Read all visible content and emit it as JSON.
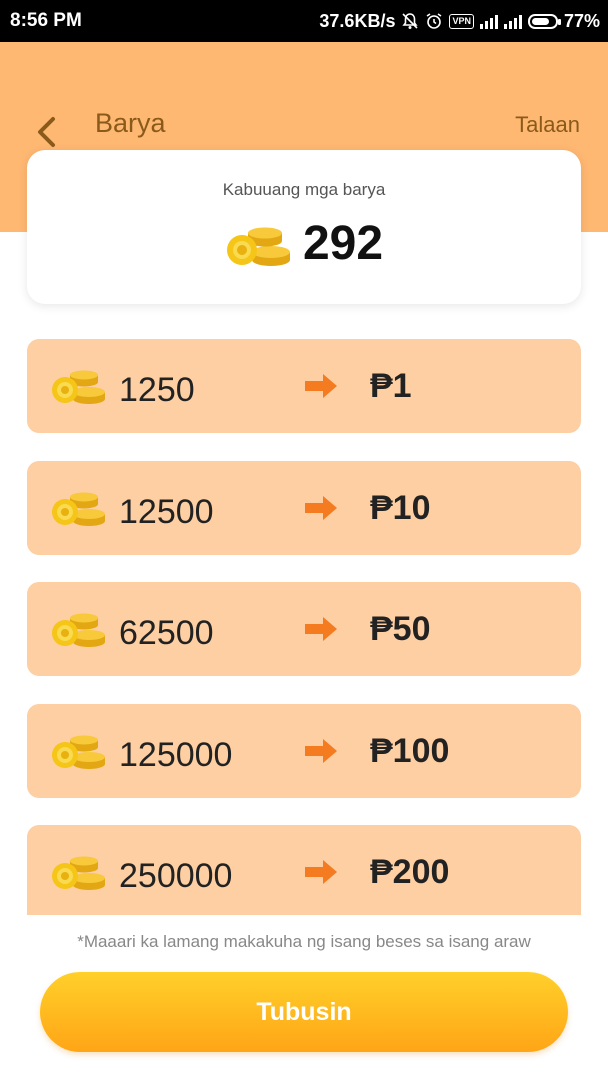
{
  "status_bar": {
    "time": "8:56 PM",
    "speed": "37.6KB/s",
    "vpn": "VPN",
    "network": "4G",
    "battery": "77%",
    "battery_level": 0.77
  },
  "header": {
    "title": "Barya",
    "history_link": "Talaan",
    "background_color": "#ffb872"
  },
  "total": {
    "label": "Kabuuang mga barya",
    "value": "292"
  },
  "options": [
    {
      "coins": "1250",
      "reward": "₱1"
    },
    {
      "coins": "12500",
      "reward": "₱10"
    },
    {
      "coins": "62500",
      "reward": "₱50"
    },
    {
      "coins": "125000",
      "reward": "₱100"
    },
    {
      "coins": "250000",
      "reward": "₱200"
    }
  ],
  "note": "*Maaari ka lamang makakuha ng isang beses sa isang araw",
  "redeem_button": "Tubusin",
  "colors": {
    "accent": "#f47b20",
    "option_bg": "#fdcfa3",
    "coin": "#f5c518"
  },
  "icons": {
    "back": "chevron-left-icon",
    "coins": "coin-stack-icon",
    "arrow": "arrow-right-icon",
    "mute": "bell-off-icon",
    "alarm": "alarm-icon"
  }
}
